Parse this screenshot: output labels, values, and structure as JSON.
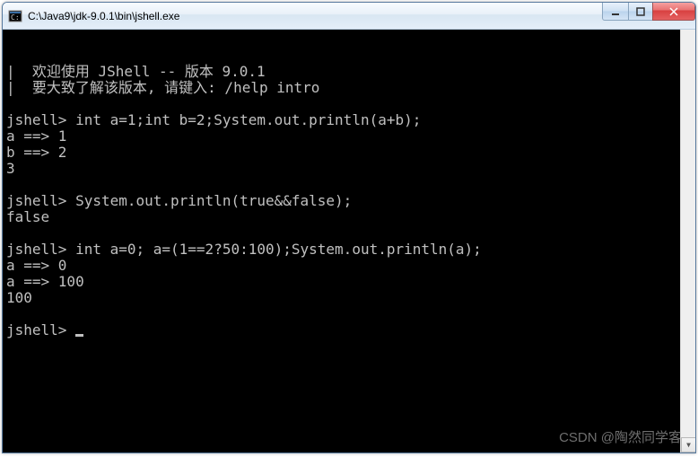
{
  "window": {
    "title": "C:\\Java9\\jdk-9.0.1\\bin\\jshell.exe"
  },
  "console": {
    "lines": [
      "|  欢迎使用 JShell -- 版本 9.0.1",
      "|  要大致了解该版本, 请键入: /help intro",
      "",
      "jshell> int a=1;int b=2;System.out.println(a+b);",
      "a ==> 1",
      "b ==> 2",
      "3",
      "",
      "jshell> System.out.println(true&&false);",
      "false",
      "",
      "jshell> int a=0; a=(1==2?50:100);System.out.println(a);",
      "a ==> 0",
      "a ==> 100",
      "100",
      "",
      "jshell> "
    ],
    "prompt_with_cursor_index": 16
  },
  "watermark": "CSDN @陶然同学客"
}
